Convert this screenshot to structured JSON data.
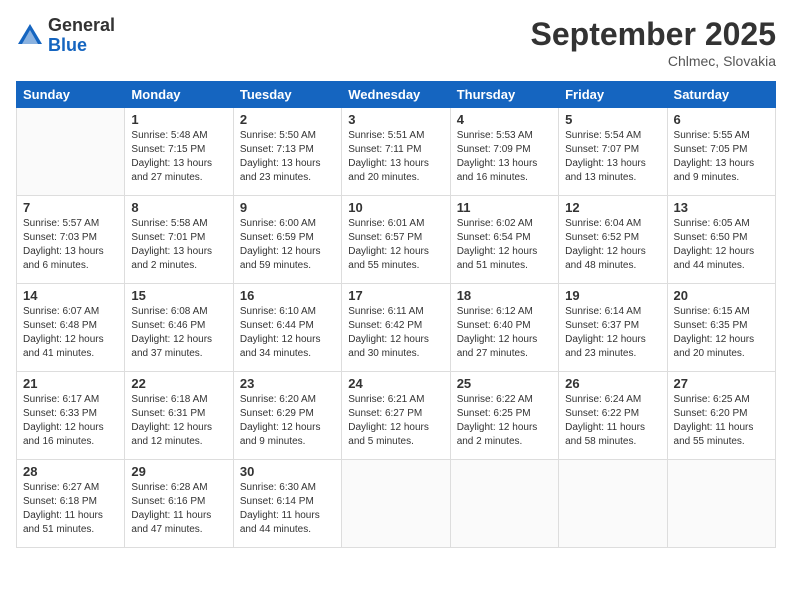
{
  "logo": {
    "general": "General",
    "blue": "Blue"
  },
  "title": "September 2025",
  "location": "Chlmec, Slovakia",
  "days_of_week": [
    "Sunday",
    "Monday",
    "Tuesday",
    "Wednesday",
    "Thursday",
    "Friday",
    "Saturday"
  ],
  "weeks": [
    [
      {
        "day": "",
        "info": ""
      },
      {
        "day": "1",
        "info": "Sunrise: 5:48 AM\nSunset: 7:15 PM\nDaylight: 13 hours\nand 27 minutes."
      },
      {
        "day": "2",
        "info": "Sunrise: 5:50 AM\nSunset: 7:13 PM\nDaylight: 13 hours\nand 23 minutes."
      },
      {
        "day": "3",
        "info": "Sunrise: 5:51 AM\nSunset: 7:11 PM\nDaylight: 13 hours\nand 20 minutes."
      },
      {
        "day": "4",
        "info": "Sunrise: 5:53 AM\nSunset: 7:09 PM\nDaylight: 13 hours\nand 16 minutes."
      },
      {
        "day": "5",
        "info": "Sunrise: 5:54 AM\nSunset: 7:07 PM\nDaylight: 13 hours\nand 13 minutes."
      },
      {
        "day": "6",
        "info": "Sunrise: 5:55 AM\nSunset: 7:05 PM\nDaylight: 13 hours\nand 9 minutes."
      }
    ],
    [
      {
        "day": "7",
        "info": "Sunrise: 5:57 AM\nSunset: 7:03 PM\nDaylight: 13 hours\nand 6 minutes."
      },
      {
        "day": "8",
        "info": "Sunrise: 5:58 AM\nSunset: 7:01 PM\nDaylight: 13 hours\nand 2 minutes."
      },
      {
        "day": "9",
        "info": "Sunrise: 6:00 AM\nSunset: 6:59 PM\nDaylight: 12 hours\nand 59 minutes."
      },
      {
        "day": "10",
        "info": "Sunrise: 6:01 AM\nSunset: 6:57 PM\nDaylight: 12 hours\nand 55 minutes."
      },
      {
        "day": "11",
        "info": "Sunrise: 6:02 AM\nSunset: 6:54 PM\nDaylight: 12 hours\nand 51 minutes."
      },
      {
        "day": "12",
        "info": "Sunrise: 6:04 AM\nSunset: 6:52 PM\nDaylight: 12 hours\nand 48 minutes."
      },
      {
        "day": "13",
        "info": "Sunrise: 6:05 AM\nSunset: 6:50 PM\nDaylight: 12 hours\nand 44 minutes."
      }
    ],
    [
      {
        "day": "14",
        "info": "Sunrise: 6:07 AM\nSunset: 6:48 PM\nDaylight: 12 hours\nand 41 minutes."
      },
      {
        "day": "15",
        "info": "Sunrise: 6:08 AM\nSunset: 6:46 PM\nDaylight: 12 hours\nand 37 minutes."
      },
      {
        "day": "16",
        "info": "Sunrise: 6:10 AM\nSunset: 6:44 PM\nDaylight: 12 hours\nand 34 minutes."
      },
      {
        "day": "17",
        "info": "Sunrise: 6:11 AM\nSunset: 6:42 PM\nDaylight: 12 hours\nand 30 minutes."
      },
      {
        "day": "18",
        "info": "Sunrise: 6:12 AM\nSunset: 6:40 PM\nDaylight: 12 hours\nand 27 minutes."
      },
      {
        "day": "19",
        "info": "Sunrise: 6:14 AM\nSunset: 6:37 PM\nDaylight: 12 hours\nand 23 minutes."
      },
      {
        "day": "20",
        "info": "Sunrise: 6:15 AM\nSunset: 6:35 PM\nDaylight: 12 hours\nand 20 minutes."
      }
    ],
    [
      {
        "day": "21",
        "info": "Sunrise: 6:17 AM\nSunset: 6:33 PM\nDaylight: 12 hours\nand 16 minutes."
      },
      {
        "day": "22",
        "info": "Sunrise: 6:18 AM\nSunset: 6:31 PM\nDaylight: 12 hours\nand 12 minutes."
      },
      {
        "day": "23",
        "info": "Sunrise: 6:20 AM\nSunset: 6:29 PM\nDaylight: 12 hours\nand 9 minutes."
      },
      {
        "day": "24",
        "info": "Sunrise: 6:21 AM\nSunset: 6:27 PM\nDaylight: 12 hours\nand 5 minutes."
      },
      {
        "day": "25",
        "info": "Sunrise: 6:22 AM\nSunset: 6:25 PM\nDaylight: 12 hours\nand 2 minutes."
      },
      {
        "day": "26",
        "info": "Sunrise: 6:24 AM\nSunset: 6:22 PM\nDaylight: 11 hours\nand 58 minutes."
      },
      {
        "day": "27",
        "info": "Sunrise: 6:25 AM\nSunset: 6:20 PM\nDaylight: 11 hours\nand 55 minutes."
      }
    ],
    [
      {
        "day": "28",
        "info": "Sunrise: 6:27 AM\nSunset: 6:18 PM\nDaylight: 11 hours\nand 51 minutes."
      },
      {
        "day": "29",
        "info": "Sunrise: 6:28 AM\nSunset: 6:16 PM\nDaylight: 11 hours\nand 47 minutes."
      },
      {
        "day": "30",
        "info": "Sunrise: 6:30 AM\nSunset: 6:14 PM\nDaylight: 11 hours\nand 44 minutes."
      },
      {
        "day": "",
        "info": ""
      },
      {
        "day": "",
        "info": ""
      },
      {
        "day": "",
        "info": ""
      },
      {
        "day": "",
        "info": ""
      }
    ]
  ]
}
